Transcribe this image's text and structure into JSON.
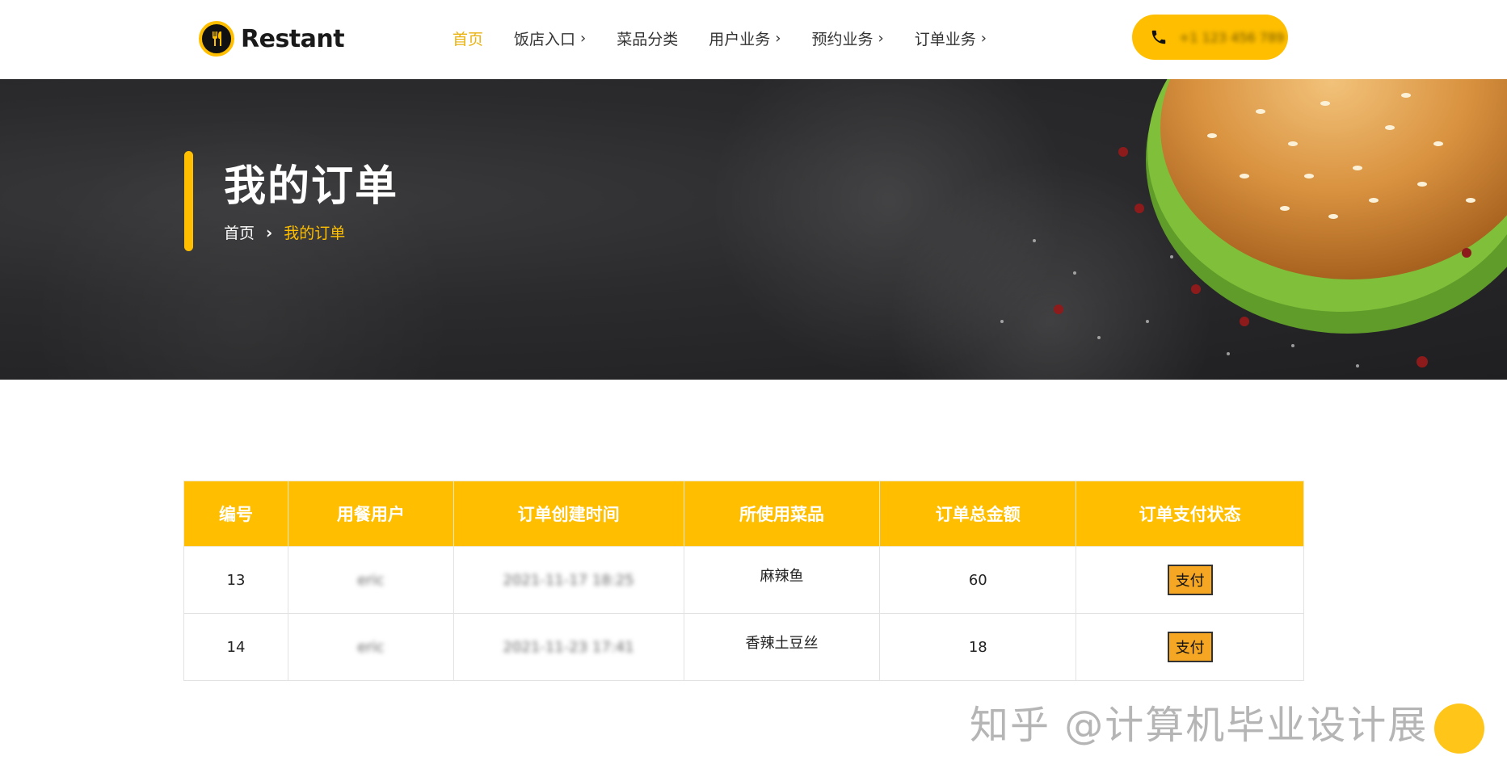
{
  "brand": {
    "name": "Restant"
  },
  "nav": [
    {
      "label": "首页",
      "active": true,
      "has_submenu": false
    },
    {
      "label": "饭店入口",
      "active": false,
      "has_submenu": true
    },
    {
      "label": "菜品分类",
      "active": false,
      "has_submenu": false
    },
    {
      "label": "用户业务",
      "active": false,
      "has_submenu": true
    },
    {
      "label": "预约业务",
      "active": false,
      "has_submenu": true
    },
    {
      "label": "订单业务",
      "active": false,
      "has_submenu": true
    }
  ],
  "phone": {
    "icon": "phone-icon",
    "text": "+1 123 456 789"
  },
  "hero": {
    "title": "我的订单",
    "breadcrumb": {
      "home": "首页",
      "separator": "›",
      "current": "我的订单"
    }
  },
  "orders_table": {
    "columns": [
      "编号",
      "用餐用户",
      "订单创建时间",
      "所使用菜品",
      "订单总金额",
      "订单支付状态"
    ],
    "rows": [
      {
        "id": "13",
        "user": "eric",
        "created": "2021-11-17 18:25",
        "dish": "麻辣鱼",
        "total": "60",
        "pay_label": "支付"
      },
      {
        "id": "14",
        "user": "eric",
        "created": "2021-11-23 17:41",
        "dish": "香辣土豆丝",
        "total": "18",
        "pay_label": "支付"
      }
    ]
  },
  "watermark": "知乎 @计算机毕业设计展",
  "colors": {
    "accent": "#FFBF00",
    "nav_active": "#E9B20E",
    "pay_button": "#F5A623"
  }
}
